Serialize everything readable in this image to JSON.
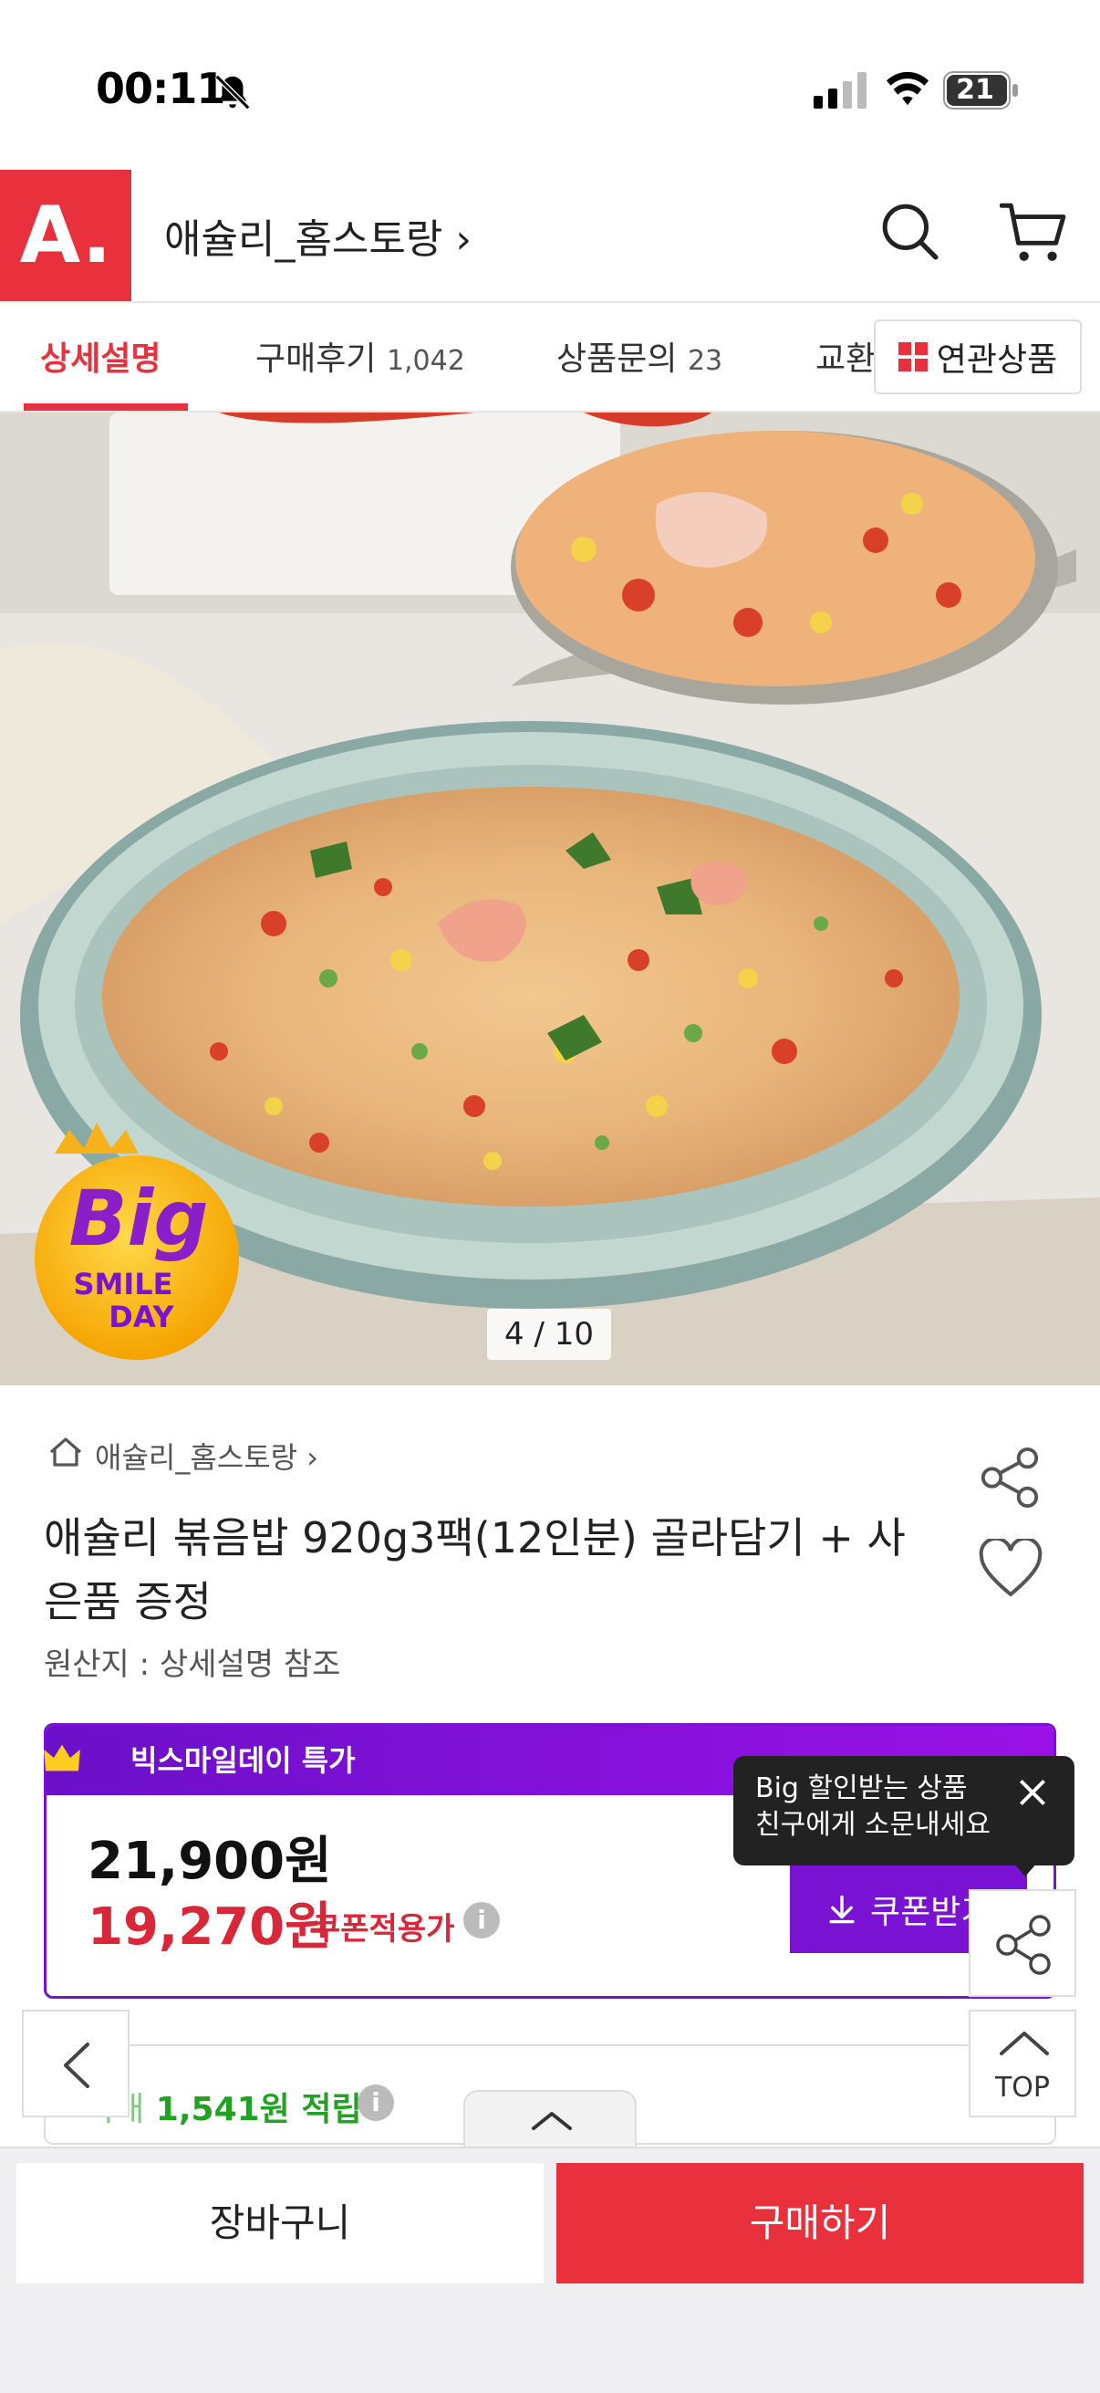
{
  "status_bar": {
    "time": "00:11",
    "battery": "21"
  },
  "header": {
    "logo": "A.",
    "store_title": "애슐리_홈스토랑 ›"
  },
  "tabs": [
    {
      "label": "상세설명",
      "count": ""
    },
    {
      "label": "구매후기",
      "count": "1,042"
    },
    {
      "label": "상품문의",
      "count": "23"
    },
    {
      "label": "교환",
      "count": ""
    }
  ],
  "related_button": "연관상품",
  "gallery": {
    "counter": "4 / 10",
    "badge_top": "Big",
    "badge_line1": "SMILE",
    "badge_line2": "DAY"
  },
  "product": {
    "breadcrumb": "애슐리_홈스토랑 ›",
    "name": "애슐리 볶음밥 920g3팩(12인분) 골라담기 + 사은품 증정",
    "origin": "원산지 : 상세설명 참조"
  },
  "deal": {
    "header": "빅스마일데이 특가",
    "original_price": "21,900원",
    "sale_price": "19,270원",
    "coupon_label": "쿠폰적용가",
    "coupon_button": "쿠폰받기"
  },
  "tooltip": {
    "line1": "Big 할인받는 상품",
    "line2": "친구에게 소문내세요"
  },
  "points": {
    "prefix": "최대",
    "amount": "1,541원 적립"
  },
  "floating": {
    "top_label": "TOP"
  },
  "bottom": {
    "cart": "장바구니",
    "buy": "구매하기"
  },
  "colors": {
    "brand_red": "#e8313c",
    "deal_purple": "#7a12d4",
    "sale_red": "#d9273a",
    "points_green": "#21a321"
  }
}
